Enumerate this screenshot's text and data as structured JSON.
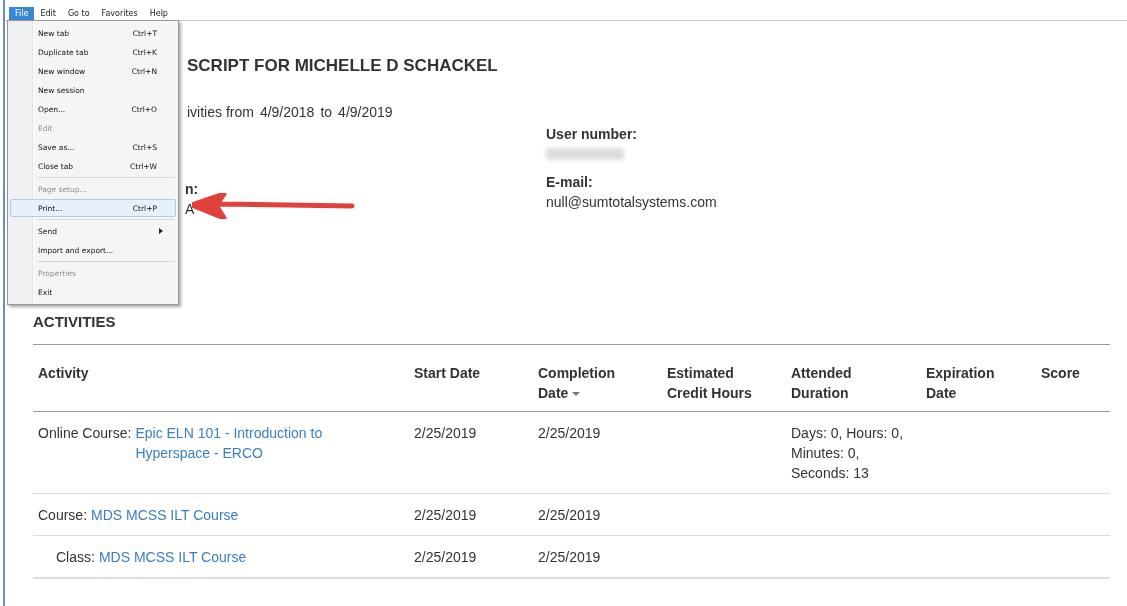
{
  "menu_bar": {
    "items": [
      {
        "label": "File",
        "selected": true
      },
      {
        "label": "Edit",
        "selected": false
      },
      {
        "label": "Go to",
        "selected": false
      },
      {
        "label": "Favorites",
        "selected": false
      },
      {
        "label": "Help",
        "selected": false
      }
    ]
  },
  "file_menu": {
    "items": [
      {
        "kind": "item",
        "label": "New tab",
        "shortcut": "Ctrl+T",
        "disabled": false,
        "selected": false
      },
      {
        "kind": "item",
        "label": "Duplicate tab",
        "shortcut": "Ctrl+K",
        "disabled": false,
        "selected": false
      },
      {
        "kind": "item",
        "label": "New window",
        "shortcut": "Ctrl+N",
        "disabled": false,
        "selected": false
      },
      {
        "kind": "item",
        "label": "New session",
        "disabled": false,
        "selected": false
      },
      {
        "kind": "item",
        "label": "Open...",
        "shortcut": "Ctrl+O",
        "disabled": false,
        "selected": false
      },
      {
        "kind": "item",
        "label": "Edit",
        "disabled": true,
        "selected": false
      },
      {
        "kind": "item",
        "label": "Save as...",
        "shortcut": "Ctrl+S",
        "disabled": false,
        "selected": false
      },
      {
        "kind": "item",
        "label": "Close tab",
        "shortcut": "Ctrl+W",
        "disabled": false,
        "selected": false
      },
      {
        "kind": "separator"
      },
      {
        "kind": "item",
        "label": "Page setup...",
        "disabled": true,
        "selected": false
      },
      {
        "kind": "item",
        "label": "Print...",
        "shortcut": "Ctrl+P",
        "disabled": false,
        "selected": true
      },
      {
        "kind": "separator"
      },
      {
        "kind": "submenu",
        "label": "Send",
        "disabled": false,
        "selected": false
      },
      {
        "kind": "item",
        "label": "Import and export...",
        "disabled": false,
        "selected": false
      },
      {
        "kind": "separator"
      },
      {
        "kind": "item",
        "label": "Properties",
        "disabled": true,
        "selected": false
      },
      {
        "kind": "item",
        "label": "Exit",
        "disabled": false,
        "selected": false
      }
    ]
  },
  "page": {
    "title": "SCRIPT FOR MICHELLE D SCHACKEL",
    "date_range": {
      "prefix": "ivities from",
      "from": "4/9/2018",
      "joiner": "to",
      "to": "4/9/2019"
    },
    "left_field": {
      "label": "n:",
      "value": "A"
    },
    "fields": [
      {
        "label": "User number:",
        "redacted": true
      },
      {
        "label": "E-mail:",
        "value": "null@sumtotalsystems.com"
      }
    ],
    "section_title": "ACTIVITIES",
    "table": {
      "columns": [
        {
          "label": "Activity"
        },
        {
          "label": "Start Date"
        },
        {
          "label": "Completion Date",
          "sorted": true
        },
        {
          "label": "Estimated Credit Hours"
        },
        {
          "label": "Attended Duration"
        },
        {
          "label": "Expiration Date"
        },
        {
          "label": "Score"
        }
      ],
      "rows": [
        {
          "type": "Online Course:",
          "link": "Epic ELN 101 - Introduction to Hyperspace - ERCO",
          "start": "2/25/2019",
          "completion": "2/25/2019",
          "duration": "Days: 0, Hours: 0, Minutes: 0, Seconds: 13"
        },
        {
          "type": "Course:",
          "link": "MDS MCSS ILT Course",
          "start": "2/25/2019",
          "completion": "2/25/2019",
          "children": [
            {
              "type": "Class:",
              "link": "MDS MCSS ILT Course",
              "start": "2/25/2019",
              "completion": "2/25/2019"
            }
          ]
        }
      ]
    }
  }
}
